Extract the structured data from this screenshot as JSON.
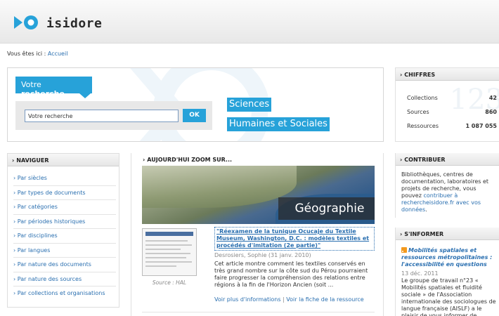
{
  "header": {
    "logo_text": "isidore"
  },
  "breadcrumb": {
    "prefix": "Vous êtes ici :",
    "home": "Accueil"
  },
  "search": {
    "title_prefix": "Votre",
    "title_bold": "recherche",
    "input_value": "Votre recherche",
    "ok_label": "OK",
    "tagline_1": "Sciences",
    "tagline_2": "Humaines et Sociales"
  },
  "chiffres": {
    "heading": "CHIFFRES",
    "rows": [
      {
        "label": "Collections",
        "value": "42"
      },
      {
        "label": "Sources",
        "value": "860"
      },
      {
        "label": "Ressources",
        "value": "1 087 055"
      }
    ]
  },
  "naviguer": {
    "heading": "NAVIGUER",
    "items": [
      "› Par siècles",
      "› Par types de documents",
      "› Par catégories",
      "› Par périodes historiques",
      "› Par disciplines",
      "› Par langues",
      "› Par nature des documents",
      "› Par nature des sources",
      "› Par collections et organisations"
    ]
  },
  "zoom": {
    "heading": "AUJOURD'HUI ZOOM SUR...",
    "image_label": "Géographie",
    "thumb_caption": "Source : HAL",
    "article_title": "\"Réexamen de la tunique Ocucaje du Textile Museum, Washington, D.C. : modèles textiles et procédés d'imitation (2e partie)\"",
    "author": "Desrosiers, Sophie (31 janv. 2010)",
    "description": "Cet article montre comment les textiles conservés en très grand nombre sur la côte sud du Pérou pourraient faire progresser la compréhension des relations entre régions à la fin de l'Horizon Ancien (soit ...",
    "link_more": "Voir plus d'informations",
    "link_sep": "|",
    "link_fiche": "Voir la fiche de la ressource"
  },
  "contribuer": {
    "heading": "CONTRIBUER",
    "text": "Bibliothèques, centres de documentation, laboratoires et projets de recherche, vous pouvez",
    "link": "contribuer à rechercheisidore.fr avec vos données",
    "tail": "."
  },
  "informer": {
    "heading": "S'INFORMER",
    "title": "Mobilités spatiales et ressources métropolitaines : l'accessibilité en questions",
    "date": "13 déc. 2011",
    "text": "Le groupe de travail n°23 « Mobilités spatiales et fluidité sociale » de l'Association internationale des sociologues de langue française (AISLF) a le plaisir de vous informer de"
  },
  "colors": {
    "accent": "#27a2d9",
    "link": "#2a6fb0"
  }
}
